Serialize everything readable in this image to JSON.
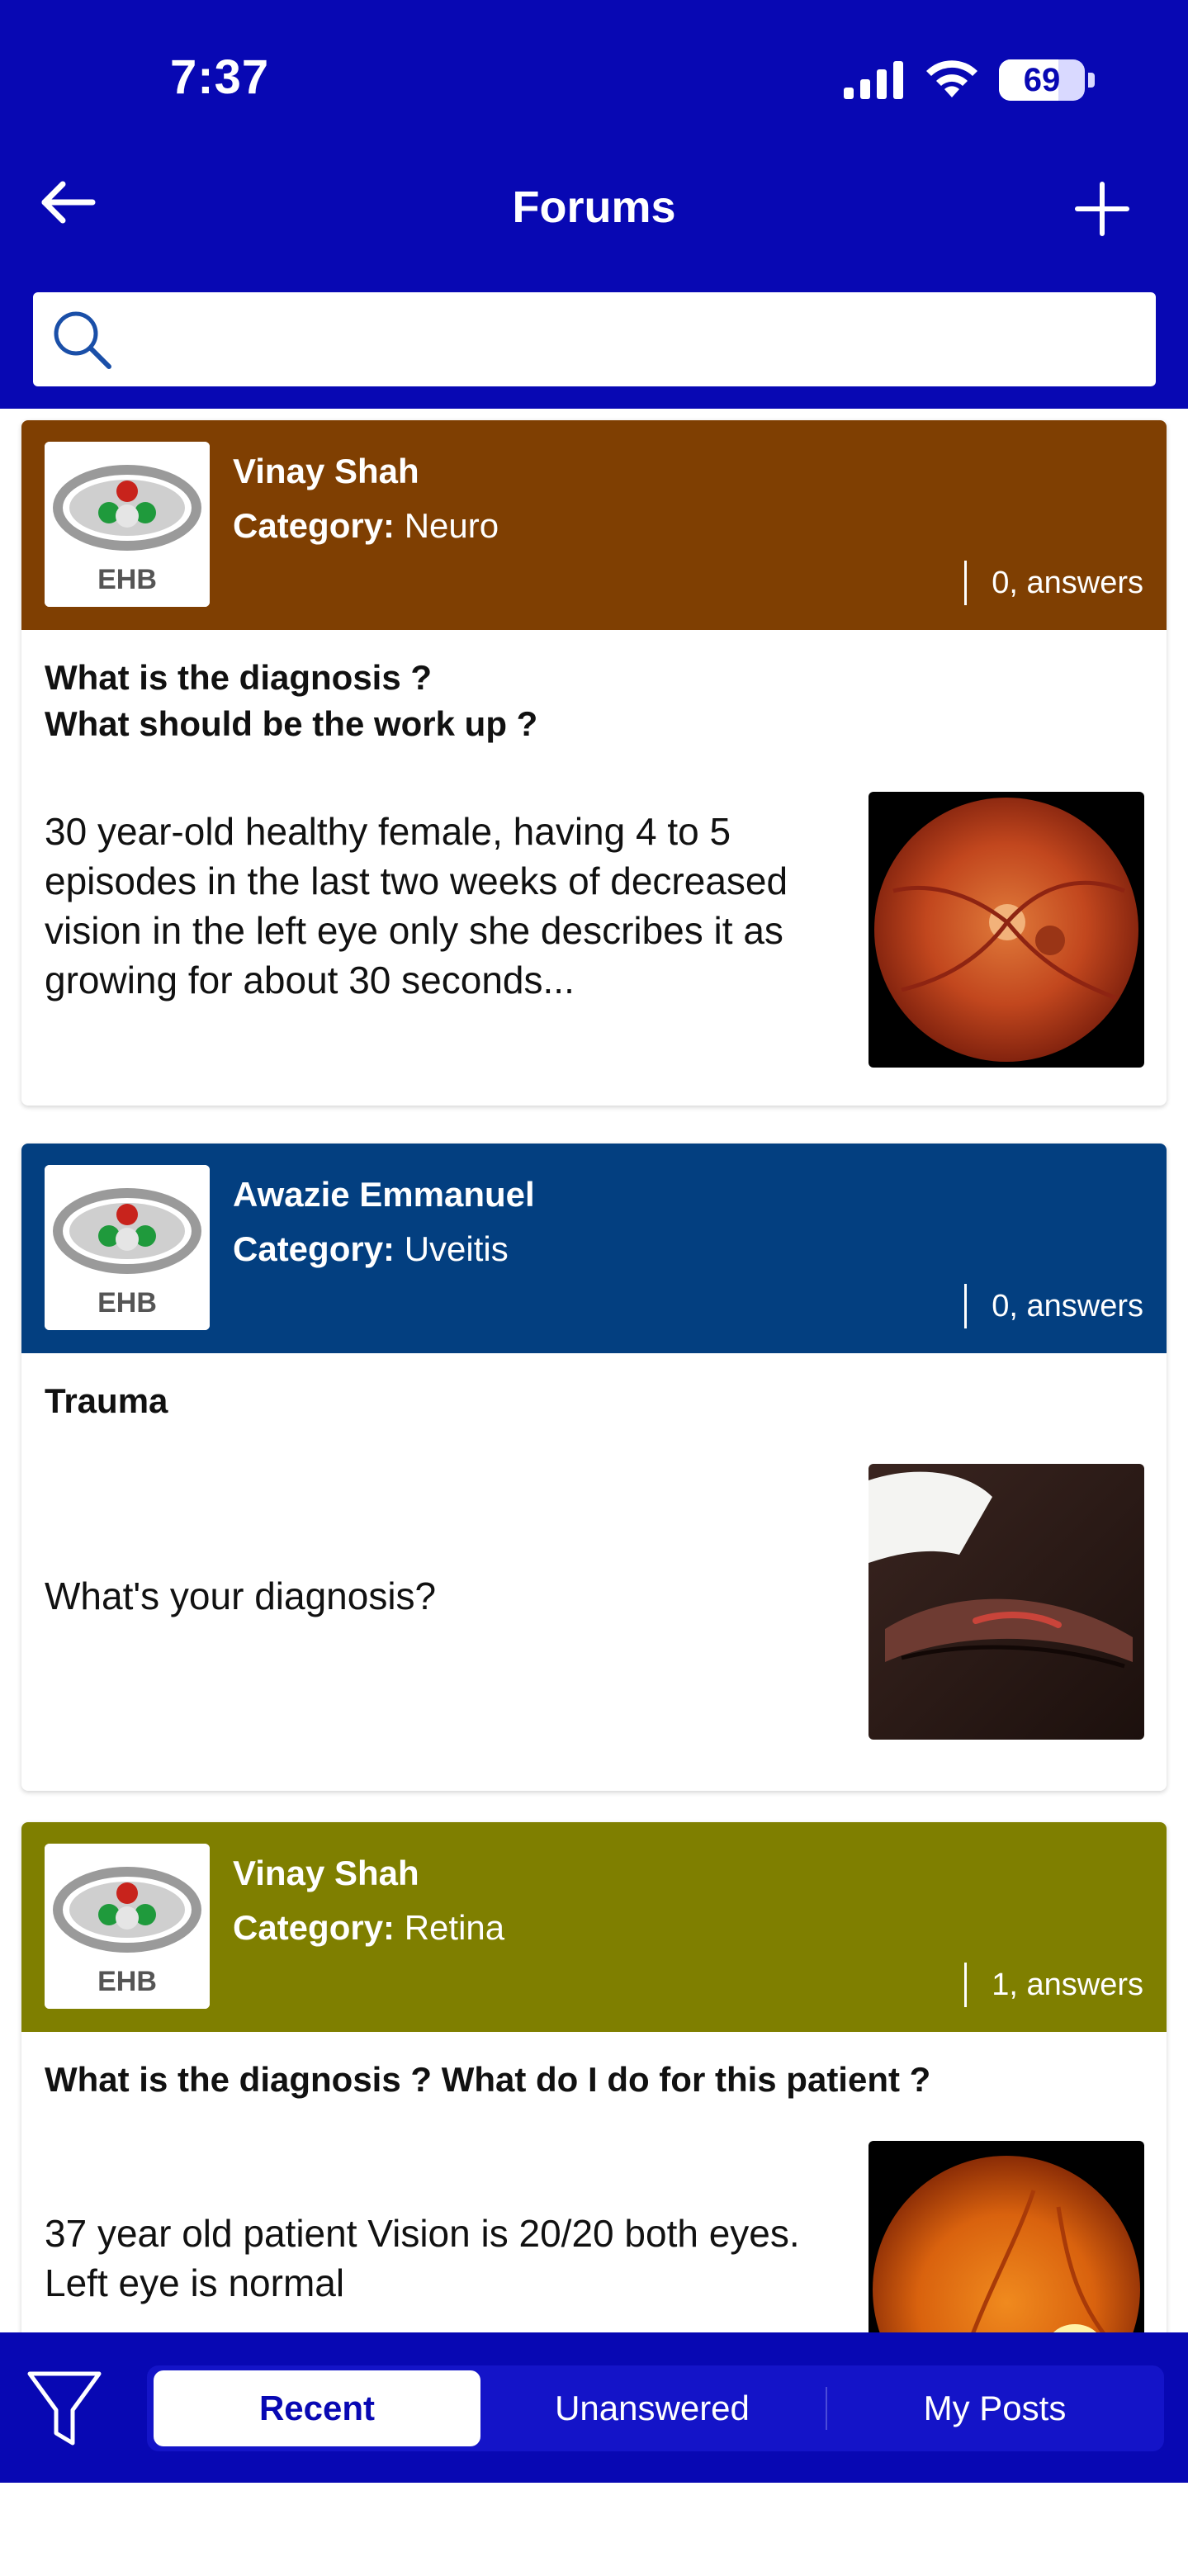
{
  "status_bar": {
    "time": "7:37",
    "battery_percent": 69,
    "battery_label": "69",
    "icons": [
      "signal-icon",
      "wifi-icon",
      "battery-icon"
    ]
  },
  "nav": {
    "title": "Forums",
    "back_icon": "arrow-left-icon",
    "add_icon": "plus-icon"
  },
  "search": {
    "placeholder": "",
    "value": "",
    "icon": "search-icon"
  },
  "posts": [
    {
      "author": "Vinay Shah",
      "category_label": "Category:",
      "category": "Neuro",
      "answers": "0, answers",
      "header_color": "#7f3f02",
      "title_lines": [
        "What is the diagnosis ?",
        "What should be the work up ?"
      ],
      "description": "30 year-old healthy female, having 4 to 5 episodes in the last two weeks of decreased vision in the left eye only she describes it as growing for about 30 seconds...",
      "image": "fundus-photo"
    },
    {
      "author": "Awazie Emmanuel",
      "category_label": "Category:",
      "category": "Uveitis",
      "answers": "0, answers",
      "header_color": "#033f80",
      "title_lines": [
        "Trauma"
      ],
      "description": "What's your diagnosis?",
      "image": "eyelid-injury-photo"
    },
    {
      "author": "Vinay Shah",
      "category_label": "Category:",
      "category": "Retina",
      "answers": "1, answers",
      "header_color": "#7f7f00",
      "title_lines": [
        "What is the diagnosis ? What do I do for this patient ?"
      ],
      "description": "37 year old patient Vision is 20/20 both eyes.\nLeft eye is normal",
      "image": "fundus-lesion-photo"
    }
  ],
  "bottom_bar": {
    "filter_icon": "filter-icon",
    "tabs": [
      {
        "label": "Recent",
        "active": true
      },
      {
        "label": "Unanswered",
        "active": false
      },
      {
        "label": "My Posts",
        "active": false
      }
    ]
  },
  "colors": {
    "primary": "#0808b3",
    "white": "#ffffff"
  }
}
